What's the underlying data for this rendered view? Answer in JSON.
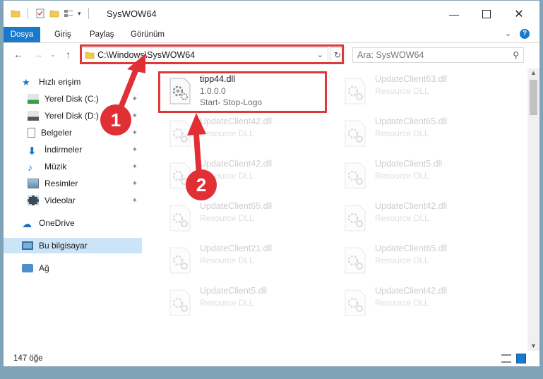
{
  "window": {
    "title": "SysWOW64"
  },
  "ribbon": {
    "tabs": [
      "Dosya",
      "Giriş",
      "Paylaş",
      "Görünüm"
    ]
  },
  "address": {
    "path": "C:\\Windows\\SysWOW64",
    "search_placeholder": "Ara: SysWOW64"
  },
  "sidebar": {
    "items": [
      {
        "label": "Hızlı erişim",
        "icon": "star-icon"
      },
      {
        "label": "Yerel Disk (C:)",
        "icon": "drive-icon"
      },
      {
        "label": "Yerel Disk (D:)",
        "icon": "drive-icon"
      },
      {
        "label": "Belgeler",
        "icon": "documents-icon"
      },
      {
        "label": "İndirmeler",
        "icon": "download-icon"
      },
      {
        "label": "Müzik",
        "icon": "music-icon"
      },
      {
        "label": "Resimler",
        "icon": "pictures-icon"
      },
      {
        "label": "Videolar",
        "icon": "videos-icon"
      },
      {
        "label": "OneDrive",
        "icon": "cloud-icon"
      },
      {
        "label": "Bu bilgisayar",
        "icon": "computer-icon"
      },
      {
        "label": "Ağ",
        "icon": "network-icon"
      }
    ]
  },
  "files": {
    "highlighted": {
      "name": "tipp44.dll",
      "version": "1.0.0.0",
      "description": "Start- Stop-Logo"
    },
    "left_column": [
      {
        "name": "UpdateClient42.dll",
        "type": "Resource DLL"
      },
      {
        "name": "UpdateClient42.dll",
        "type": "Resource DLL"
      },
      {
        "name": "UpdateClient65.dll",
        "type": "Resource DLL"
      },
      {
        "name": "UpdateClient21.dll",
        "type": "Resource DLL"
      },
      {
        "name": "UpdateClient5.dll",
        "type": "Resource DLL"
      }
    ],
    "right_column": [
      {
        "name": "UpdateClient63.dll",
        "type": "Resource DLL"
      },
      {
        "name": "UpdateClient65.dll",
        "type": "Resource DLL"
      },
      {
        "name": "UpdateClient5.dll",
        "type": "Resource DLL"
      },
      {
        "name": "UpdateClient42.dll",
        "type": "Resource DLL"
      },
      {
        "name": "UpdateClient65.dll",
        "type": "Resource DLL"
      },
      {
        "name": "UpdateClient42.dll",
        "type": "Resource DLL"
      }
    ]
  },
  "status": {
    "count": "147 öğe"
  },
  "annotations": {
    "step1": "1",
    "step2": "2"
  },
  "colors": {
    "accent": "#1979ca",
    "highlight_red": "#e0373a"
  }
}
